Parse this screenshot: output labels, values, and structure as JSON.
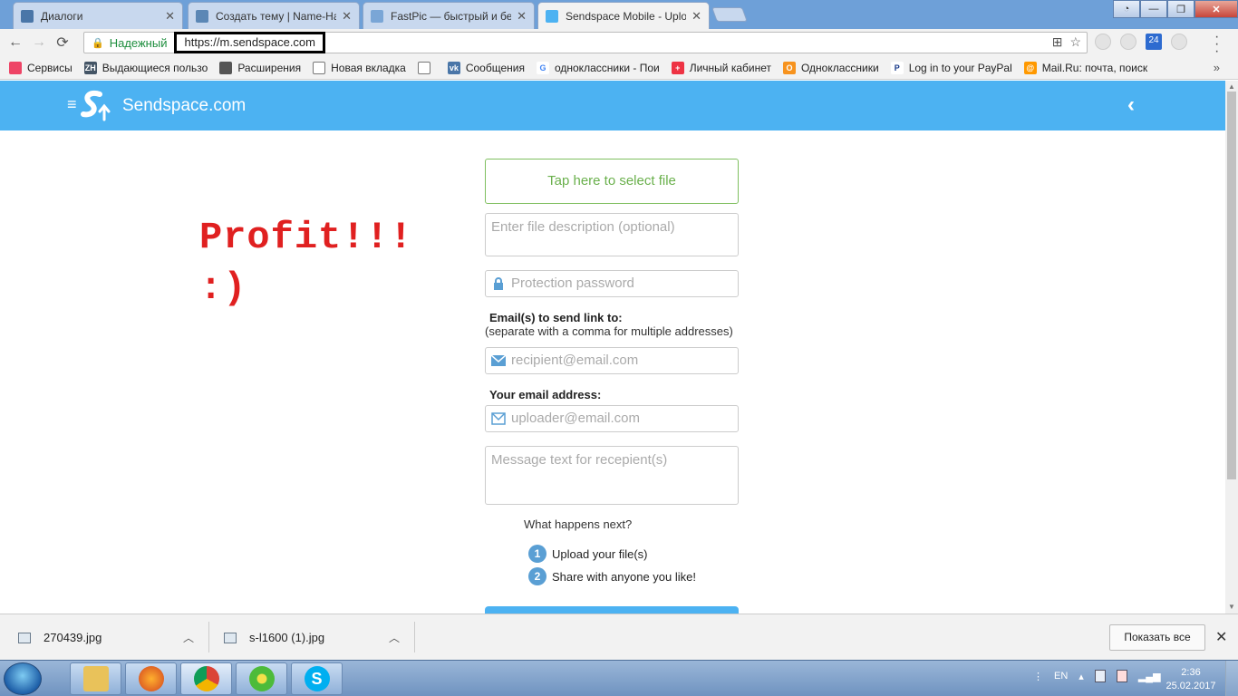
{
  "tabs": [
    {
      "title": "Диалоги"
    },
    {
      "title": "Создать тему | Name-Ha"
    },
    {
      "title": "FastPic — быстрый и бе"
    },
    {
      "title": "Sendspace Mobile - Uplo"
    }
  ],
  "toolbar": {
    "secure_label": "Надежный",
    "url": "https://m.sendspace.com",
    "ext_badge": "24"
  },
  "bookmarks": [
    "Сервисы",
    "Выдающиеся пользо",
    "Расширения",
    "Новая вкладка",
    "",
    "Сообщения",
    "одноклассники - Пои",
    "Личный кабинет",
    "Одноклассники",
    "Log in to your PayPal",
    "Mail.Ru: почта, поиск"
  ],
  "site": {
    "brand": "Sendspace.com"
  },
  "annotation": {
    "line1": "Profit!!!",
    "line2": ":)"
  },
  "form": {
    "select_file": "Tap here to select file",
    "description_placeholder": "Enter file description (optional)",
    "password_placeholder": "Protection password",
    "emails_label": "Email(s) to send link to:",
    "emails_hint": "(separate with a comma for multiple addresses)",
    "recipient_placeholder": "recipient@email.com",
    "your_email_label": "Your email address:",
    "uploader_placeholder": "uploader@email.com",
    "message_placeholder": "Message text for recepient(s)",
    "next_title": "What happens next?",
    "step1_num": "1",
    "step1": "Upload your file(s)",
    "step2_num": "2",
    "step2": "Share with anyone you like!"
  },
  "downloads": {
    "file1": "270439.jpg",
    "file2": "s-l1600 (1).jpg",
    "show_all": "Показать все"
  },
  "taskbar": {
    "lang": "EN",
    "time": "2:36",
    "date": "25.02.2017"
  },
  "colors": {
    "header": "#4cb2f2",
    "select_file": "#6ab04c",
    "annotation": "#e02020",
    "step_badge": "#5a9fd4"
  }
}
